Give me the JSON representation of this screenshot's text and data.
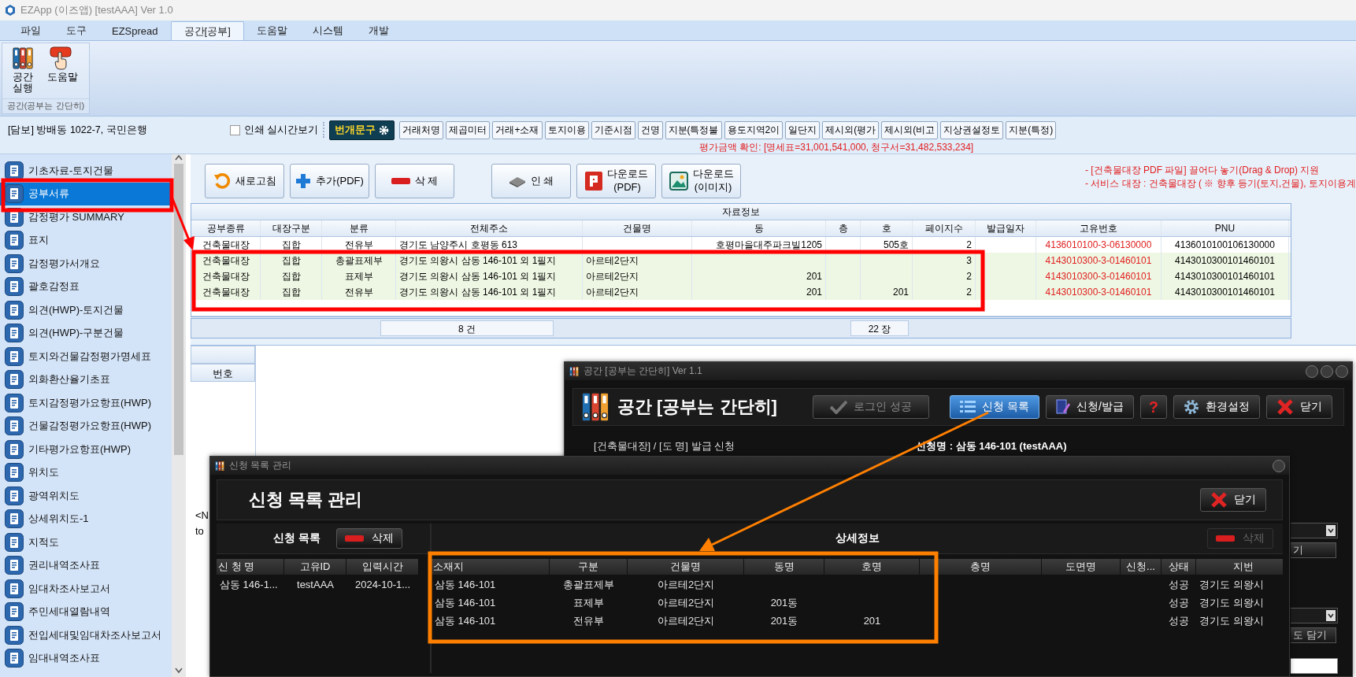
{
  "window": {
    "title": "EZApp (이즈앱) [testAAA] Ver 1.0"
  },
  "menu_tabs": [
    {
      "label": "파일",
      "selected": false
    },
    {
      "label": "도구",
      "selected": false
    },
    {
      "label": "EZSpread",
      "selected": false
    },
    {
      "label": "공간[공부]",
      "selected": true
    },
    {
      "label": "도움말",
      "selected": false
    },
    {
      "label": "시스템",
      "selected": false
    },
    {
      "label": "개발",
      "selected": false
    }
  ],
  "ribbon": {
    "buttons": [
      {
        "label": "공간 실행",
        "kind": "binders"
      },
      {
        "label": "도움말",
        "kind": "help"
      }
    ],
    "group_label": "공간(공부는 간단히)"
  },
  "info_bar": {
    "collateral": "[담보] 방배동 1022-7, 국민은행",
    "realtime_print": {
      "label": "인쇄 실시간보기",
      "checked": false
    },
    "phrase_button": "번개문구",
    "phrase_buttons": [
      "거래처명",
      "제곱미터",
      "거래+소재",
      "토지이용",
      "기준시점",
      "건명",
      "지분(특정불",
      "용도지역2이",
      "일단지",
      "제시외(평가",
      "제시외(비고",
      "지상권설정토",
      "지분(특정)"
    ],
    "amount_check": "평가금액 확인: [명세표=31,001,541,000, 청구서=31,482,533,234]"
  },
  "sidebar": {
    "items": [
      {
        "label": "기초자료-토지건물",
        "selected": false
      },
      {
        "label": "공부서류",
        "selected": true
      },
      {
        "label": "감정평가 SUMMARY",
        "selected": false
      },
      {
        "label": "표지",
        "selected": false
      },
      {
        "label": "감정평가서개요",
        "selected": false
      },
      {
        "label": "괄호감정표",
        "selected": false
      },
      {
        "label": "의견(HWP)-토지건물",
        "selected": false
      },
      {
        "label": "의견(HWP)-구분건물",
        "selected": false
      },
      {
        "label": "토지와건물감정평가명세표",
        "selected": false
      },
      {
        "label": "외화환산율기초표",
        "selected": false
      },
      {
        "label": "토지감정평가요항표(HWP)",
        "selected": false
      },
      {
        "label": "건물감정평가요항표(HWP)",
        "selected": false
      },
      {
        "label": "기타평가요항표(HWP)",
        "selected": false
      },
      {
        "label": "위치도",
        "selected": false
      },
      {
        "label": "광역위치도",
        "selected": false
      },
      {
        "label": "상세위치도-1",
        "selected": false
      },
      {
        "label": "지적도",
        "selected": false
      },
      {
        "label": "권리내역조사표",
        "selected": false
      },
      {
        "label": "임대차조사보고서",
        "selected": false
      },
      {
        "label": "주민세대열람내역",
        "selected": false
      },
      {
        "label": "전입세대및임대차조사보고서",
        "selected": false
      },
      {
        "label": "임대내역조사표",
        "selected": false
      }
    ]
  },
  "toolbar": {
    "buttons": [
      {
        "label": "새로고침",
        "kind": "refresh"
      },
      {
        "label": "추가(PDF)",
        "kind": "add"
      },
      {
        "label": "삭 제",
        "kind": "delete"
      },
      {
        "label": "인 쇄",
        "kind": "print"
      },
      {
        "label": "다운로드",
        "sublabel": "(PDF)",
        "kind": "pdf"
      },
      {
        "label": "다운로드",
        "sublabel": "(이미지)",
        "kind": "image"
      }
    ],
    "notes": [
      "- [건축물대장 PDF 파일] 끌어다 놓기(Drag & Drop) 지원",
      "- 서비스 대장 : 건축물대장 ( ※ 향후 등기(토지,건물), 토지이용계"
    ]
  },
  "table": {
    "group_header": "자료정보",
    "columns": [
      "공부종류",
      "대장구분",
      "분류",
      "전체주소",
      "건물명",
      "동",
      "층",
      "호",
      "페이지수",
      "발급일자",
      "고유번호",
      "PNU"
    ],
    "rows": [
      {
        "doc_type": "건축물대장",
        "ledger": "집합",
        "category": "전유부",
        "address": "경기도 남양주시 호평동 613",
        "dong": "호평마을대주파크빌1205",
        "unit": "505호",
        "pages": "2",
        "unique_no": "4136010100-3-06130000",
        "pnu": "4136010100106130000",
        "selected": false
      },
      {
        "doc_type": "건축물대장",
        "ledger": "집합",
        "category": "총괄표제부",
        "address": "경기도 의왕시 삼동 146-101 외 1필지",
        "building": "아르테2단지",
        "pages": "3",
        "unique_no": "4143010300-3-01460101",
        "pnu": "4143010300101460101",
        "selected": true
      },
      {
        "doc_type": "건축물대장",
        "ledger": "집합",
        "category": "표제부",
        "address": "경기도 의왕시 삼동 146-101 외 1필지",
        "building": "아르테2단지",
        "dong": "201",
        "pages": "2",
        "unique_no": "4143010300-3-01460101",
        "pnu": "4143010300101460101",
        "selected": true
      },
      {
        "doc_type": "건축물대장",
        "ledger": "집합",
        "category": "전유부",
        "address": "경기도 의왕시 삼동 146-101 외 1필지",
        "building": "아르테2단지",
        "dong": "201",
        "unit": "201",
        "pages": "2",
        "unique_no": "4143010300-3-01460101",
        "pnu": "4143010300101460101",
        "selected": true
      }
    ],
    "footer": {
      "count": "8 건",
      "pages": "22 장"
    }
  },
  "lower_pane": {
    "column": "번호",
    "message_lines": [
      "<N",
      "to"
    ]
  },
  "app_window": {
    "title": "공간 [공부는 간단히] Ver 1.1",
    "heading": "공간 [공부는 간단히]",
    "buttons": [
      {
        "label": "로그인 성공",
        "kind": "check",
        "selected": false,
        "disabled": true
      },
      {
        "label": "신청 목록",
        "kind": "list",
        "selected": true,
        "disabled": false
      },
      {
        "label": "신청/발급",
        "kind": "pen",
        "selected": false,
        "disabled": false
      },
      {
        "label": "?",
        "kind": "plain",
        "selected": false,
        "disabled": false
      },
      {
        "label": "환경설정",
        "kind": "gear",
        "selected": false,
        "disabled": false
      },
      {
        "label": "닫기",
        "kind": "close",
        "selected": false,
        "disabled": false
      }
    ],
    "tab_text": "[건축물대장]  / [도 명]  발급 신청",
    "request_name": "신청명 : 삼동 146-101  (testAAA)",
    "side_buttons": [
      "기",
      "도 담기"
    ]
  },
  "list_window": {
    "title": "신청 목록 관리",
    "heading": "신청 목록 관리",
    "close_button": "닫기",
    "left": {
      "label": "신청 목록",
      "delete_button": {
        "label": "삭제",
        "disabled": false
      },
      "columns": [
        "신 청 명",
        "고유ID",
        "입력시간"
      ],
      "rows": [
        {
          "name": "삼동 146-1...",
          "id": "testAAA",
          "time": "2024-10-1..."
        }
      ]
    },
    "right": {
      "label": "상세정보",
      "delete_button": {
        "label": "삭제",
        "disabled": true
      },
      "columns": [
        "소재지",
        "구분",
        "건물명",
        "동명",
        "호명",
        "층명",
        "도면명",
        "신청...",
        "상태",
        "지번"
      ],
      "rows": [
        {
          "location": "삼동 146-101",
          "division": "총괄표제부",
          "building": "아르테2단지",
          "status": "성공",
          "lot": "경기도 의왕시"
        },
        {
          "location": "삼동 146-101",
          "division": "표제부",
          "building": "아르테2단지",
          "dong": "201동",
          "status": "성공",
          "lot": "경기도 의왕시"
        },
        {
          "location": "삼동 146-101",
          "division": "전유부",
          "building": "아르테2단지",
          "dong": "201동",
          "unit": "201",
          "status": "성공",
          "lot": "경기도 의왕시"
        }
      ]
    }
  }
}
